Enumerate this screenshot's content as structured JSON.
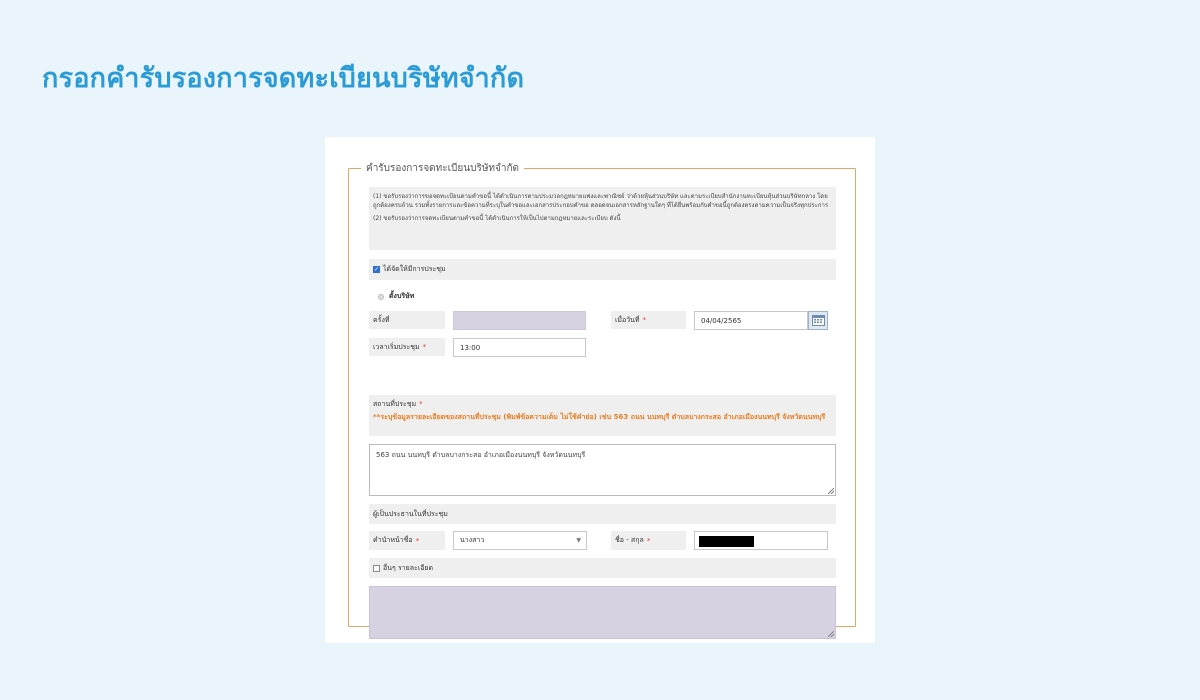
{
  "page_title": "กรอกคำรับรองการจดทะเบียนบริษัทจำกัด",
  "form": {
    "legend": "คำรับรองการจดทะเบียนบริษัทจำกัด",
    "terms": [
      "(1) ขอรับรองว่าการขอจดทะเบียนตามคำขอนี้ ได้ดำเนินการตามประมวลกฎหมายแพ่งและพาณิชย์ ว่าด้วยหุ้นส่วนบริษัท และตามระเบียบสำนักงานทะเบียนหุ้นส่วนบริษัทกลาง โดยถูกต้องครบถ้วน รวมทั้งรายการและข้อความที่ระบุในคำขอและเอกสารประกอบคำขอ ตลอดจนเอกสารหลักฐานใดๆ ที่ได้ยื่นพร้อมกับคำขอนี้ถูกต้องตรงตามความเป็นจริงทุกประการ",
      "(2) ขอรับรองว่าการจดทะเบียนตามคำขอนี้ ได้ดำเนินการให้เป็นไปตามกฎหมายและระเบียบ ดังนี้"
    ],
    "meeting_checkbox_label": "ได้จัดให้มีการประชุม",
    "meeting_checked": true,
    "radio_label": "ตั้งบริษัท",
    "session_label": "ครั้งที่",
    "session_value": "",
    "date_label": "เมื่อวันที่",
    "date_value": "04/04/2565",
    "time_label": "เวลาเริ่มประชุม",
    "time_value": "13:00",
    "place_label": "สถานที่ประชุม",
    "place_hint": "**ระบุข้อมูลรายละเอียดของสถานที่ประชุม (พิมพ์ข้อความเต็ม ไม่ใช้คำย่อ) เช่น 563 ถนน นนทบุรี ตำบลบางกระสอ อำเภอเมืองนนทบุรี จังหวัดนนทบุรี",
    "place_value": "563 ถนน นนทบุรี ตำบลบางกระสอ อำเภอเมืองนนทบุรี จังหวัดนนทบุรี",
    "chair_label": "ผู้เป็นประธานในที่ประชุม",
    "prefix_label": "คำนำหน้าชื่อ",
    "prefix_value": "นางสาว",
    "name_label": "ชื่อ - สกุล",
    "other_checkbox_label": "อื่นๆ รายละเอียด",
    "other_checked": false,
    "required_mark": "*"
  },
  "colors": {
    "heading": "#2b9bd6",
    "fieldset_border": "#e0a868",
    "hint_orange": "#e67e22",
    "required_red": "#e03a2f",
    "disabled_purple": "#d7d1e2"
  },
  "icons": {
    "calendar": "calendar-icon",
    "select_arrow": "chevron-down-icon"
  }
}
